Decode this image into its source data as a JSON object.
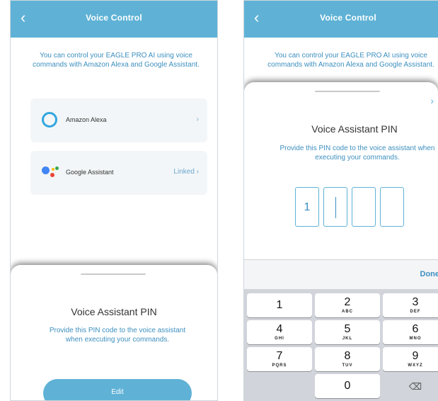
{
  "left_screen": {
    "title": "Voice Control",
    "back_glyph": "‹",
    "intro": "You can control your EAGLE PRO AI using voice commands with Amazon Alexa and Google Assistant.",
    "options": [
      {
        "label": "Amazon Alexa",
        "right": "›",
        "icon": "alexa-logo-icon"
      },
      {
        "label": "Google Assistant",
        "right": "Linked ›",
        "icon": "google-assistant-logo-icon"
      }
    ],
    "sheet": {
      "title": "Voice Assistant PIN",
      "description": "Provide this PIN code to the voice assistant when executing your commands.",
      "button": "Edit"
    }
  },
  "right_screen": {
    "title": "Voice Control",
    "back_glyph": "‹",
    "intro": "You can control your EAGLE PRO AI using voice commands with Amazon Alexa and Google Assistant.",
    "sheet": {
      "close_glyph": "›",
      "title": "Voice Assistant PIN",
      "description": "Provide this PIN code to the voice assistant when executing your commands.",
      "pin_digits": [
        "1",
        "",
        "",
        ""
      ]
    },
    "keyboard": {
      "done_label": "Done",
      "keys": [
        {
          "num": "1",
          "sub": ""
        },
        {
          "num": "2",
          "sub": "ABC"
        },
        {
          "num": "3",
          "sub": "DEF"
        },
        {
          "num": "4",
          "sub": "GHI"
        },
        {
          "num": "5",
          "sub": "JKL"
        },
        {
          "num": "6",
          "sub": "MNO"
        },
        {
          "num": "7",
          "sub": "PQRS"
        },
        {
          "num": "8",
          "sub": "TUV"
        },
        {
          "num": "9",
          "sub": "WXYZ"
        },
        {
          "num": "0",
          "sub": ""
        },
        {
          "num": "⌫",
          "sub": ""
        }
      ]
    }
  },
  "colors": {
    "accent": "#5fb2d6",
    "link_text": "#3c8fbf",
    "alexa_blue": "#33a6df",
    "google_blue": "#4285f4",
    "google_red": "#ea4335",
    "google_yellow": "#fbbc05",
    "google_green": "#34a853"
  }
}
